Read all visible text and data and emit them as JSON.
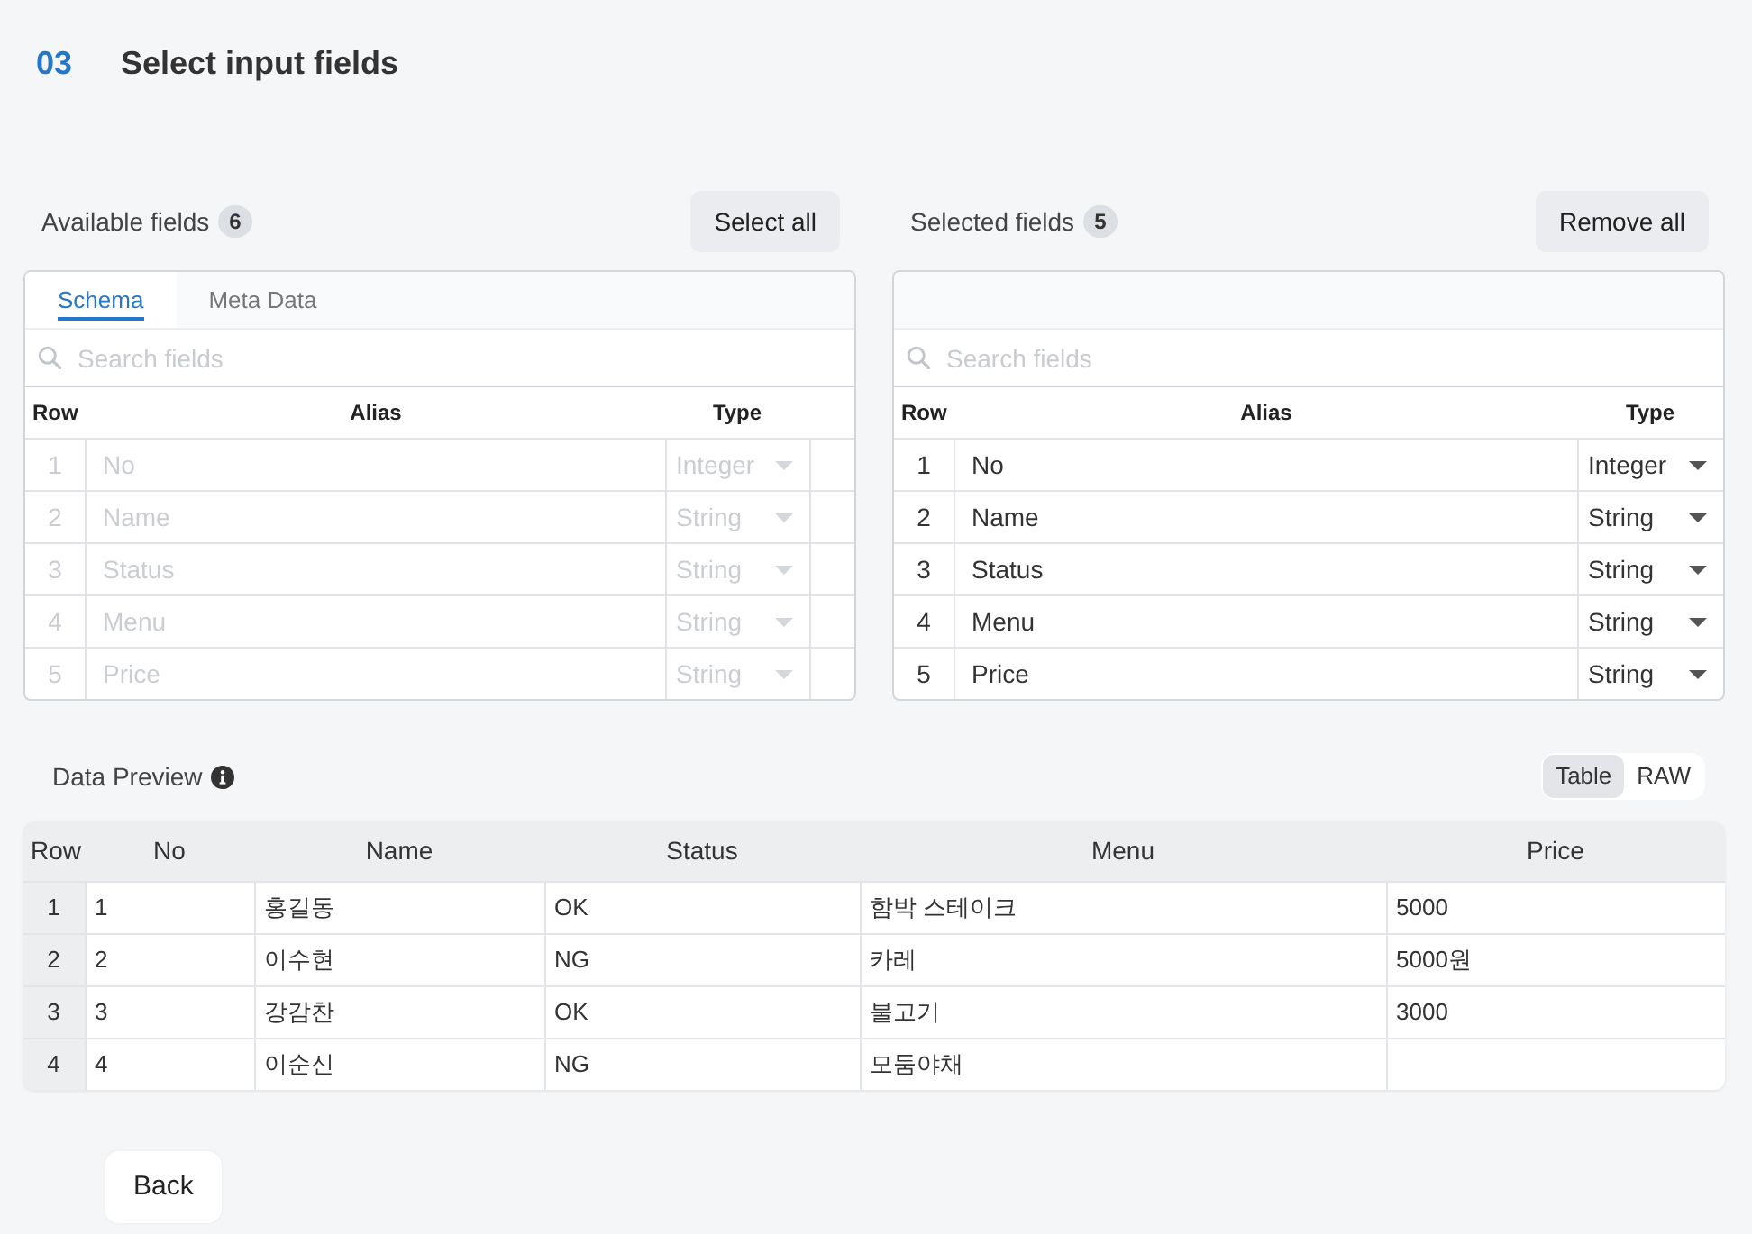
{
  "header": {
    "step": "03",
    "title": "Select input fields"
  },
  "panels": [
    {
      "label": "Available fields",
      "count": "6",
      "button": "Select all",
      "tabs": [
        {
          "label": "Schema",
          "selected": true
        },
        {
          "label": "Meta Data",
          "selected": false
        }
      ],
      "search": {
        "placeholder": "Search fields"
      },
      "columns": [
        "Row",
        "Alias",
        "Type"
      ],
      "rows": [
        {
          "row": "1",
          "alias": "No",
          "type": "Integer",
          "disabled": true
        },
        {
          "row": "2",
          "alias": "Name",
          "type": "String",
          "disabled": true
        },
        {
          "row": "3",
          "alias": "Status",
          "type": "String",
          "disabled": true
        },
        {
          "row": "4",
          "alias": "Menu",
          "type": "String",
          "disabled": true
        },
        {
          "row": "5",
          "alias": "Price",
          "type": "String",
          "disabled": true
        }
      ]
    },
    {
      "label": "Selected fields",
      "count": "5",
      "button": "Remove all",
      "search": {
        "placeholder": "Search fields"
      },
      "columns": [
        "Row",
        "Alias",
        "Type"
      ],
      "rows": [
        {
          "row": "1",
          "alias": "No",
          "type": "Integer",
          "disabled": false
        },
        {
          "row": "2",
          "alias": "Name",
          "type": "String",
          "disabled": false
        },
        {
          "row": "3",
          "alias": "Status",
          "type": "String",
          "disabled": false
        },
        {
          "row": "4",
          "alias": "Menu",
          "type": "String",
          "disabled": false
        },
        {
          "row": "5",
          "alias": "Price",
          "type": "String",
          "disabled": false
        }
      ]
    }
  ],
  "preview": {
    "label": "Data Preview",
    "view_toggle": [
      {
        "label": "Table",
        "selected": true
      },
      {
        "label": "RAW",
        "selected": false
      }
    ],
    "columns": [
      "Row",
      "No",
      "Name",
      "Status",
      "Menu",
      "Price"
    ],
    "rows": [
      {
        "row": "1",
        "no": "1",
        "name": "홍길동",
        "status": "OK",
        "menu": "함박 스테이크",
        "price": "5000"
      },
      {
        "row": "2",
        "no": "2",
        "name": "이수현",
        "status": "NG",
        "menu": "카레",
        "price": "5000원"
      },
      {
        "row": "3",
        "no": "3",
        "name": "강감찬",
        "status": "OK",
        "menu": "불고기",
        "price": "3000"
      },
      {
        "row": "4",
        "no": "4",
        "name": "이순신",
        "status": "NG",
        "menu": "모둠야채"
      }
    ]
  },
  "back_button": "Back"
}
